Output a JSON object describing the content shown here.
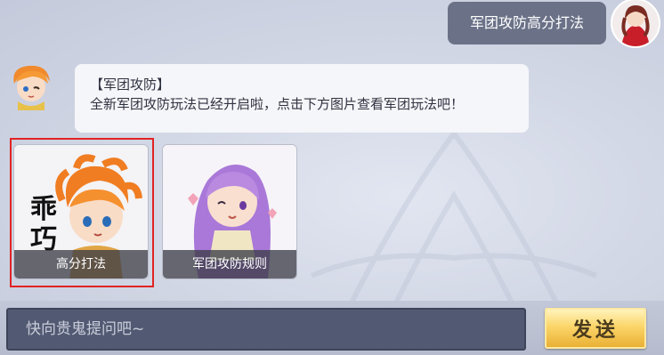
{
  "chat": {
    "user_message": "军团攻防高分打法",
    "bot_message": {
      "title": "【军团攻防】",
      "body": "全新军团攻防玩法已经开启啦，点击下方图片查看军团玩法吧！"
    },
    "cards": [
      {
        "label": "高分打法",
        "sticker_text": "乖巧",
        "selected": true,
        "icon": "orange-hair-chibi-icon"
      },
      {
        "label": "军团攻防规则",
        "selected": false,
        "icon": "purple-hair-chibi-icon"
      }
    ]
  },
  "input": {
    "placeholder": "快向贵鬼提问吧~",
    "value": ""
  },
  "send_button": {
    "label": "发送"
  },
  "colors": {
    "highlight": "#e02424",
    "user_bubble": "#6b7288",
    "input_bg": "#525a73",
    "send_gold": "#fbd66a"
  }
}
